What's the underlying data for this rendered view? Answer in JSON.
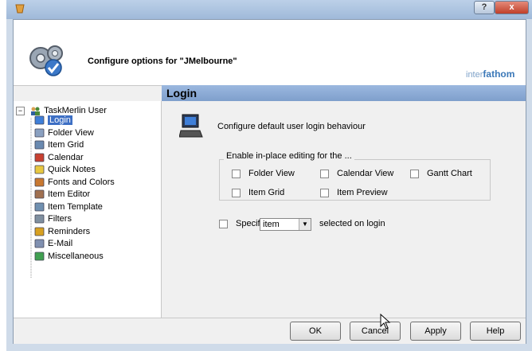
{
  "window": {
    "help_label": "?",
    "close_label": "x"
  },
  "header": {
    "title": "Configure options for \"JMelbourne\"",
    "brand_small": "inter",
    "brand_big": "fathom",
    "icon": "gears-check-icon"
  },
  "pane": {
    "title": "Login"
  },
  "tree": {
    "root": "TaskMerlin User",
    "expander": "−",
    "items": [
      {
        "label": "Login",
        "icon": "computer-icon",
        "selected": true
      },
      {
        "label": "Folder View",
        "icon": "folder-view-icon"
      },
      {
        "label": "Item Grid",
        "icon": "grid-icon"
      },
      {
        "label": "Calendar",
        "icon": "calendar-icon"
      },
      {
        "label": "Quick Notes",
        "icon": "note-icon"
      },
      {
        "label": "Fonts and Colors",
        "icon": "fonts-icon"
      },
      {
        "label": "Item Editor",
        "icon": "editor-icon"
      },
      {
        "label": "Item Template",
        "icon": "template-icon"
      },
      {
        "label": "Filters",
        "icon": "filter-icon"
      },
      {
        "label": "Reminders",
        "icon": "bell-icon"
      },
      {
        "label": "E-Mail",
        "icon": "email-icon"
      },
      {
        "label": "Miscellaneous",
        "icon": "misc-icon"
      }
    ]
  },
  "content": {
    "description": "Configure default user login behaviour",
    "group_label": "Enable in-place editing for the ...",
    "checks": {
      "folder_view": "Folder View",
      "calendar_view": "Calendar View",
      "gantt_chart": "Gantt Chart",
      "item_grid": "Item Grid",
      "item_preview": "Item Preview"
    },
    "specify_label": "Specify",
    "specify_value": "item",
    "specify_suffix": "selected on login"
  },
  "footer": {
    "ok": "OK",
    "cancel": "Cancel",
    "apply": "Apply",
    "help": "Help"
  }
}
